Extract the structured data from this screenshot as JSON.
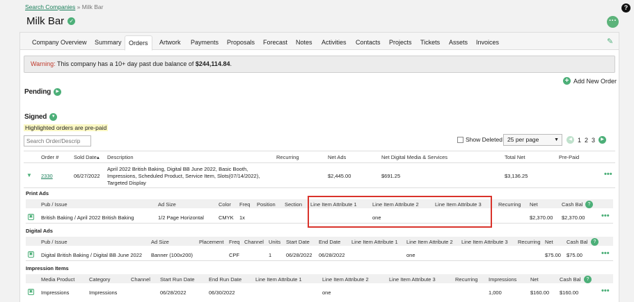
{
  "breadcrumb": {
    "link": "Search Companies",
    "separator": "»",
    "current": "Milk Bar"
  },
  "help_icon": "?",
  "page_title": "Milk Bar",
  "tabs": [
    {
      "label": "Company Overview",
      "active": false
    },
    {
      "label": "Summary",
      "active": false
    },
    {
      "label": "Orders",
      "active": true
    },
    {
      "label": "Artwork",
      "active": false
    },
    {
      "label": "Payments",
      "active": false
    },
    {
      "label": "Proposals",
      "active": false
    },
    {
      "label": "Forecast",
      "active": false
    },
    {
      "label": "Notes",
      "active": false
    },
    {
      "label": "Activities",
      "active": false
    },
    {
      "label": "Contacts",
      "active": false
    },
    {
      "label": "Projects",
      "active": false
    },
    {
      "label": "Tickets",
      "active": false
    },
    {
      "label": "Assets",
      "active": false
    },
    {
      "label": "Invoices",
      "active": false
    }
  ],
  "warning": {
    "label": "Warning:",
    "text": " This company has a 10+ day past due balance of ",
    "amount": "$244,114.84",
    "end": "."
  },
  "add_order": "Add New Order",
  "pending_label": "Pending",
  "signed_label": "Signed",
  "prepaid_note": "Highlighted orders are pre-paid",
  "search": {
    "placeholder": "Search Order/Descrip"
  },
  "show_deleted": "Show Deleted",
  "per_page": "25 per page",
  "pages": [
    "1",
    "2",
    "3"
  ],
  "orders_table": {
    "headers": {
      "order": "Order #",
      "sold": "Sold Date",
      "sort_arrow": "▴",
      "desc": "Description",
      "recurring": "Recurring",
      "net_ads": "Net Ads",
      "net_digital": "Net Digital Media & Services",
      "total_net": "Total Net",
      "prepaid": "Pre-Paid"
    },
    "row": {
      "order": "2330",
      "sold": "06/27/2022",
      "desc_lines": [
        "April 2022 British Baking, Digital BB June 2022, Basic Booth,",
        "Impressions, Scheduled Product, Service Item, Slots(07/14/2022),",
        "Targeted Display"
      ],
      "net_ads": "$2,445.00",
      "net_digital": "$691.25",
      "total_net": "$3,136.25"
    }
  },
  "print_ads": {
    "title": "Print Ads",
    "headers": {
      "pub": "Pub / Issue",
      "ad_size": "Ad Size",
      "color": "Color",
      "freq": "Freq",
      "position": "Position",
      "section": "Section",
      "attr1": "Line Item Attribute 1",
      "attr2": "Line Item Attribute 2",
      "attr3": "Line Item Attribute 3",
      "recurring": "Recurring",
      "net": "Net",
      "cash_bal": "Cash Bal"
    },
    "row": {
      "pub": "British Baking / April 2022 British Baking",
      "ad_size": "1/2 Page Horizontal",
      "color": "CMYK",
      "freq": "1x",
      "attr2": "one",
      "net": "$2,370.00",
      "cash_bal": "$2,370.00"
    }
  },
  "digital_ads": {
    "title": "Digital Ads",
    "headers": {
      "pub": "Pub / Issue",
      "ad_size": "Ad Size",
      "placement": "Placement",
      "freq": "Freq",
      "channel": "Channel",
      "units": "Units",
      "start": "Start Date",
      "end": "End Date",
      "attr1": "Line Item Attribute 1",
      "attr2": "Line Item Attribute 2",
      "attr3": "Line Item Attribute 3",
      "recurring": "Recurring",
      "net": "Net",
      "cash_bal": "Cash Bal"
    },
    "row": {
      "pub": "Digital British Baking / Digital BB June 2022",
      "ad_size": "Banner (100x200)",
      "freq": "CPF",
      "units": "1",
      "start": "06/28/2022",
      "end": "06/28/2022",
      "attr2": "one",
      "net": "$75.00",
      "cash_bal": "$75.00"
    }
  },
  "impression_items": {
    "title": "Impression Items",
    "headers": {
      "media": "Media Product",
      "category": "Category",
      "channel": "Channel",
      "start": "Start Run Date",
      "end": "End Run Date",
      "attr1": "Line Item Attribute 1",
      "attr2": "Line Item Attribute 2",
      "attr3": "Line Item Attribute 3",
      "recurring": "Recurring",
      "impressions": "Impressions",
      "net": "Net",
      "cash_bal": "Cash Bal"
    },
    "row": {
      "media": "Impressions",
      "category": "Impressions",
      "start": "06/28/2022",
      "end": "06/30/2022",
      "attr1": "one",
      "impressions": "1,000",
      "net": "$160.00",
      "cash_bal": "$160.00"
    }
  },
  "more_dots": "•••",
  "colors": {
    "accent": "#4caf78",
    "link": "#1a7f5a",
    "warning": "#c0392b",
    "highlight": "#d9332b"
  }
}
